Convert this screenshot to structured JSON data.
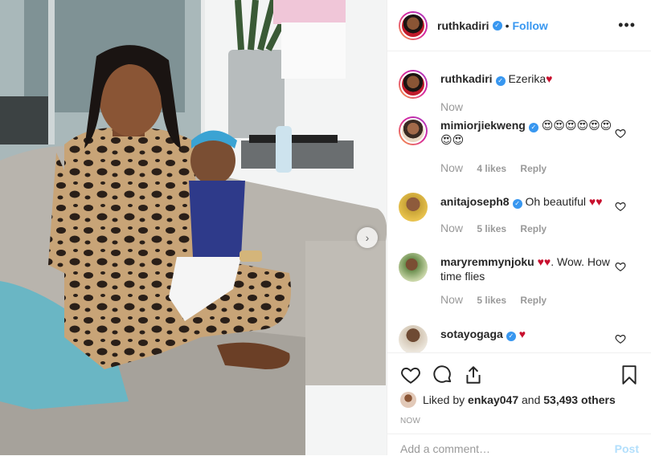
{
  "header": {
    "username": "ruthkadiri",
    "separator": "•",
    "follow_label": "Follow",
    "more_label": "•••"
  },
  "caption": {
    "username": "ruthkadiri",
    "text": "Ezerika",
    "time": "Now"
  },
  "comments": [
    {
      "username": "mimiorjiekweng",
      "text": "😍😍😍😍😍😍😍😍",
      "time": "Now",
      "likes": "4 likes",
      "reply": "Reply"
    },
    {
      "username": "anitajoseph8",
      "text": "Oh beautiful",
      "hearts": "♥♥",
      "time": "Now",
      "likes": "5 likes",
      "reply": "Reply"
    },
    {
      "username": "maryremmynjoku",
      "hearts": "♥♥",
      "text": ". Wow. How time flies",
      "time": "Now",
      "likes": "5 likes",
      "reply": "Reply"
    },
    {
      "username": "sotayogaga",
      "hearts": "♥"
    }
  ],
  "likes": {
    "prefix": "Liked by",
    "user": "enkay047",
    "conjunction": "and",
    "others": "53,493 others"
  },
  "posted_time": "NOW",
  "add_comment": {
    "placeholder": "Add a comment…",
    "post_label": "Post"
  },
  "colors": {
    "accent": "#3897f0",
    "heart": "#c8102e",
    "muted": "#999999"
  },
  "icons": [
    "verified-badge-icon",
    "heart-icon",
    "comment-icon",
    "share-icon",
    "bookmark-icon",
    "chevron-right-icon",
    "more-icon"
  ]
}
